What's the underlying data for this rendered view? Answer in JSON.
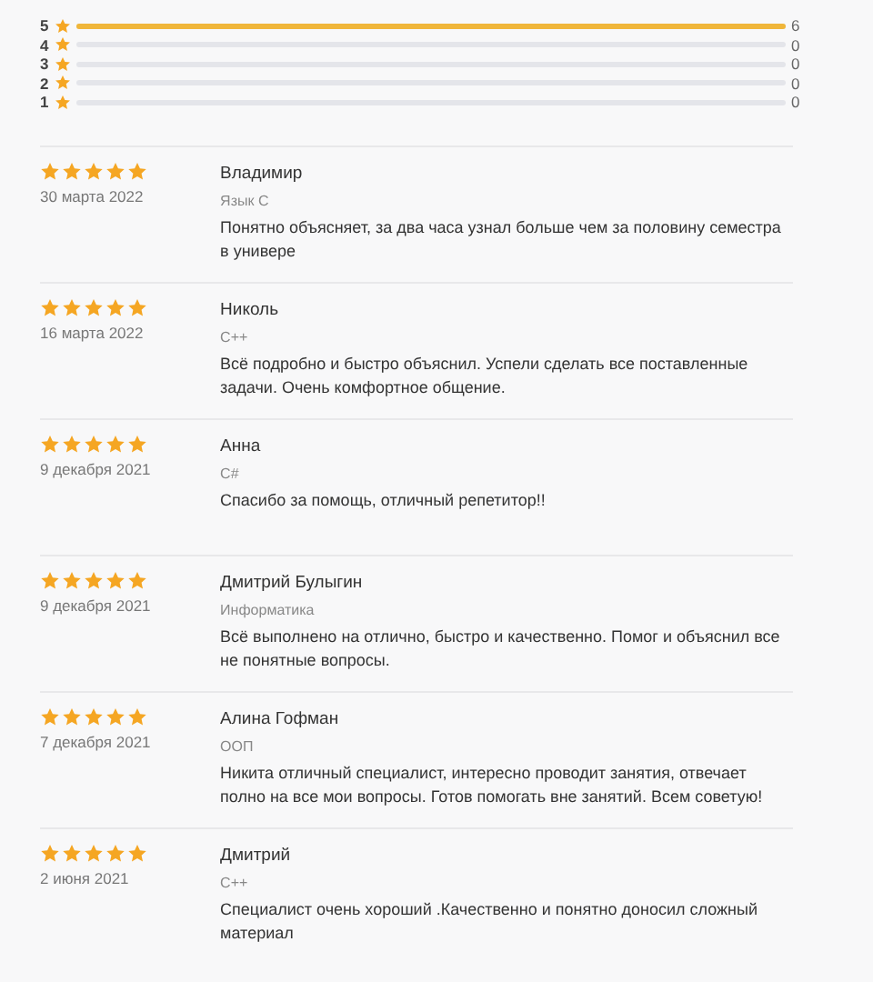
{
  "rating_bars": [
    {
      "label": "5",
      "level": 1,
      "count": "6"
    },
    {
      "label": "4",
      "level": 0,
      "count": "0"
    },
    {
      "label": "3",
      "level": 0,
      "count": "0"
    },
    {
      "label": "2",
      "level": 0,
      "count": "0"
    },
    {
      "label": "1",
      "level": 0,
      "count": "0"
    }
  ],
  "reviews": [
    {
      "stars": 5,
      "date": "30 марта 2022",
      "name": "Владимир",
      "subject": "Язык C",
      "text": "Понятно объясняет, за два часа узнал больше чем за половину семестра в универе"
    },
    {
      "stars": 5,
      "date": "16 марта 2022",
      "name": "Николь",
      "subject": "C++",
      "text": "Всё подробно и быстро объяснил. Успели сделать все поставленные задачи. Очень комфортное общение."
    },
    {
      "stars": 5,
      "date": "9 декабря 2021",
      "name": "Анна",
      "subject": "C#",
      "text": "Спасибо за помощь, отличный репетитор!!"
    },
    {
      "stars": 5,
      "date": "9 декабря 2021",
      "name": "Дмитрий Булыгин",
      "subject": "Информатика",
      "text": "Всё выполнено на отлично, быстро и качественно. Помог и объяснил все не понятные вопросы."
    },
    {
      "stars": 5,
      "date": "7 декабря 2021",
      "name": "Алина Гофман",
      "subject": "ООП",
      "text": "Никита отличный специалист, интересно проводит занятия, отвечает полно на все мои вопросы. Готов помогать вне занятий. Всем советую!"
    },
    {
      "stars": 5,
      "date": "2 июня 2021",
      "name": "Дмитрий",
      "subject": "C++",
      "text": "Специалист очень хороший .Качественно и понятно доносил сложный материал"
    }
  ]
}
